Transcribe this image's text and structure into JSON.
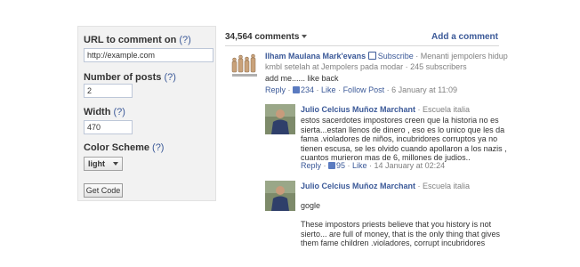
{
  "config": {
    "url_label": "URL to comment on",
    "url_value": "http://example.com",
    "posts_label": "Number of posts",
    "posts_value": "2",
    "width_label": "Width",
    "width_value": "470",
    "scheme_label": "Color Scheme",
    "scheme_value": "light",
    "help_mark": "(?)",
    "get_code": "Get Code"
  },
  "header": {
    "count": "34,564 comments",
    "add_comment": "Add a comment"
  },
  "comments": [
    {
      "name": "Ilham Maulana Mark'evans",
      "subscribe": "Subscribe",
      "meta_line1": " · Menanti jempolers hidup",
      "meta_line2": "kmbl setelah at Jempolers pada modar · 245 subscribers",
      "body": "add me...... like back",
      "reply": "Reply",
      "likes": "234",
      "like": "Like",
      "follow": "Follow Post",
      "time": "6 January at 11:09"
    },
    {
      "name": "Julio Celcius Muñoz Marchant",
      "meta": " · Escuela italia",
      "body": [
        "estos sacerdotes impostores creen que la historia no es",
        "sierta...estan llenos de dinero , eso es lo unico que les da",
        "fama .violadores de niños, incubridores corruptos ya no",
        "tienen escusa, se les olvido cuando apollaron a los nazis ,",
        "cuantos murieron mas de 6, millones de judios.."
      ],
      "reply": "Reply",
      "likes": "95",
      "like": "Like",
      "time": "14 January at 02:24"
    },
    {
      "name": "Julio Celcius Muñoz Marchant",
      "meta": " · Escuela italia",
      "body_first": "gogle",
      "body": [
        "These impostors priests believe that you history is not",
        "sierto... are full of money, that is the only thing that gives",
        "them fame children .violadores, corrupt incubridores"
      ]
    }
  ]
}
